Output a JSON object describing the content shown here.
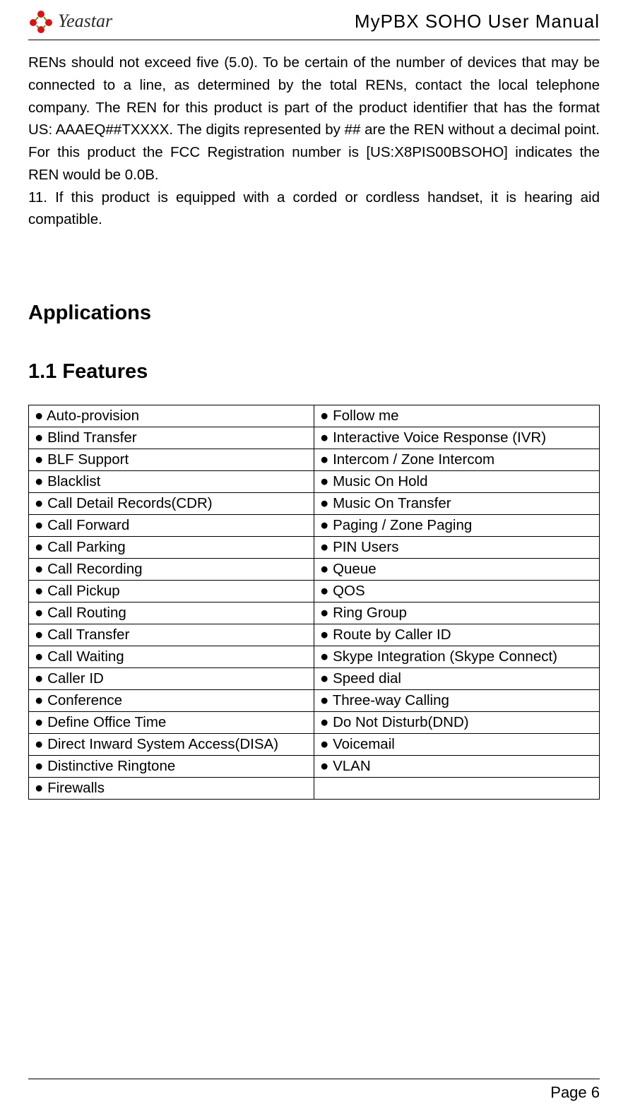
{
  "header": {
    "logo_text": "Yeastar",
    "title": "MyPBX SOHO User Manual"
  },
  "paragraphs": {
    "p1": "RENs should not exceed five (5.0). To be certain of the number of devices that may be connected to a line, as determined by the total RENs, contact the local telephone company. The REN for this product is part of the product identifier that has the format US: AAAEQ##TXXXX. The digits represented by ## are the REN without a decimal point. For this product the FCC Registration number is [US:X8PIS00BSOHO] indicates the REN would be 0.0B.",
    "p2": "11. If this product is equipped with a corded or cordless handset, it is hearing aid compatible."
  },
  "headings": {
    "applications": "Applications",
    "features": "1.1 Features"
  },
  "features": {
    "rows": [
      {
        "left": "● Auto-provision",
        "right": "● Follow me"
      },
      {
        "left": "● Blind Transfer",
        "right": "● Interactive Voice Response (IVR)"
      },
      {
        "left": "● BLF Support",
        "right": "● Intercom / Zone Intercom"
      },
      {
        "left": "● Blacklist",
        "right": "● Music On Hold"
      },
      {
        "left": "● Call Detail Records(CDR)",
        "right": "● Music On Transfer"
      },
      {
        "left": "● Call Forward",
        "right": "● Paging / Zone Paging"
      },
      {
        "left": "● Call Parking",
        "right": "● PIN Users"
      },
      {
        "left": "● Call Recording",
        "right": "● Queue"
      },
      {
        "left": "● Call Pickup",
        "right": "● QOS"
      },
      {
        "left": "● Call Routing",
        "right": "● Ring Group"
      },
      {
        "left": "● Call Transfer",
        "right": "● Route by Caller ID"
      },
      {
        "left": "● Call Waiting",
        "right": "● Skype Integration (Skype Connect)"
      },
      {
        "left": "● Caller ID",
        "right": "● Speed dial"
      },
      {
        "left": "● Conference",
        "right": "● Three-way Calling"
      },
      {
        "left": "● Define Office Time",
        "right": "● Do Not Disturb(DND)"
      },
      {
        "left": "● Direct Inward System Access(DISA)",
        "right": "● Voicemail"
      },
      {
        "left": "● Distinctive Ringtone",
        "right": "● VLAN"
      },
      {
        "left": "● Firewalls",
        "right": ""
      }
    ]
  },
  "footer": {
    "page": "Page 6"
  }
}
